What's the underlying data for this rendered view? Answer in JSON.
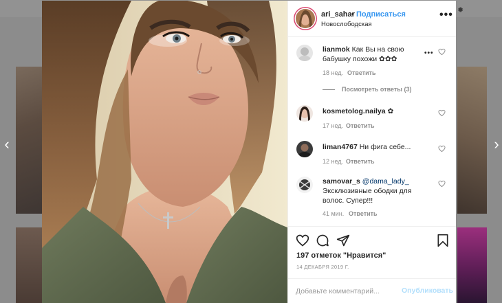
{
  "post": {
    "username": "ari_sahar",
    "separator": "•",
    "follow_label": "Подписаться",
    "location": "Новослободская",
    "more_label": "•••"
  },
  "comments": [
    {
      "username": "lianmok",
      "text": "Как Вы на свою бабушку похожи ✿✿✿",
      "time": "18 нед.",
      "reply_label": "Ответить",
      "more_label": "•••"
    },
    {
      "username": "kosmetolog.nailya",
      "text": "✿",
      "time": "17 нед.",
      "reply_label": "Ответить"
    },
    {
      "username": "liman4767",
      "text": "Ни фига себе...",
      "time": "12 нед.",
      "reply_label": "Ответить"
    },
    {
      "username": "samovar_s",
      "mention": "@dama_lady_",
      "text": "Эксклюзивные ободки для волос. Супер!!!",
      "time": "41 мин.",
      "reply_label": "Ответить"
    }
  ],
  "view_replies_label": "Посмотреть ответы (3)",
  "likes_label": "197 отметок \"Нравится\"",
  "date_label": "14 ДЕКАБРЯ 2019 Г.",
  "comment_input": {
    "placeholder": "Добавьте комментарий...",
    "value": ""
  },
  "publish_label": "Опубликовать",
  "nav": {
    "prev": "‹",
    "next": "›"
  },
  "icons": {
    "like": "heart-icon",
    "comment": "comment-icon",
    "share": "share-icon",
    "save": "bookmark-icon"
  },
  "colors": {
    "accent": "#3897f0",
    "text": "#262626",
    "muted": "#8e8e8e",
    "publish_disabled": "#b2dffc"
  }
}
